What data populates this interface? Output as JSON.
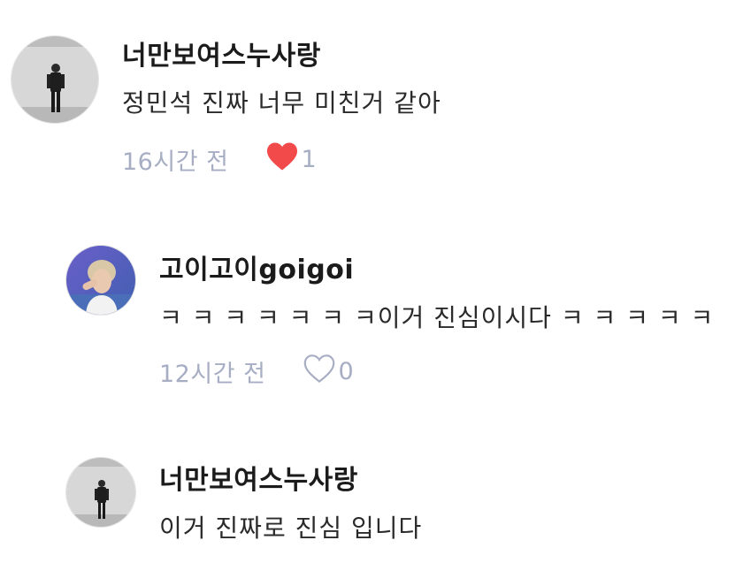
{
  "comments": [
    {
      "username": "너만보여스누사랑",
      "text": "정민석 진짜 너무 미친거 같아",
      "time": "16시간 전",
      "liked": true,
      "like_count": "1",
      "like_icon": "heart-filled-icon",
      "like_color": "#f24a4a",
      "avatar_icon": "user-avatar-standing-figure"
    },
    {
      "username": "고이고이goigoi",
      "text": "ㅋ ㅋ ㅋ ㅋ ㅋ ㅋ ㅋ이거 진심이시다 ㅋ ㅋ ㅋ ㅋ ㅋ",
      "time": "12시간 전",
      "liked": false,
      "like_count": "0",
      "like_icon": "heart-outline-icon",
      "like_color": "#a7aec4",
      "avatar_icon": "user-avatar-portrait"
    },
    {
      "username": "너만보여스누사랑",
      "text": "이거 진짜로 진심 입니다",
      "time": "",
      "liked": false,
      "like_count": "",
      "avatar_icon": "user-avatar-standing-figure"
    }
  ]
}
